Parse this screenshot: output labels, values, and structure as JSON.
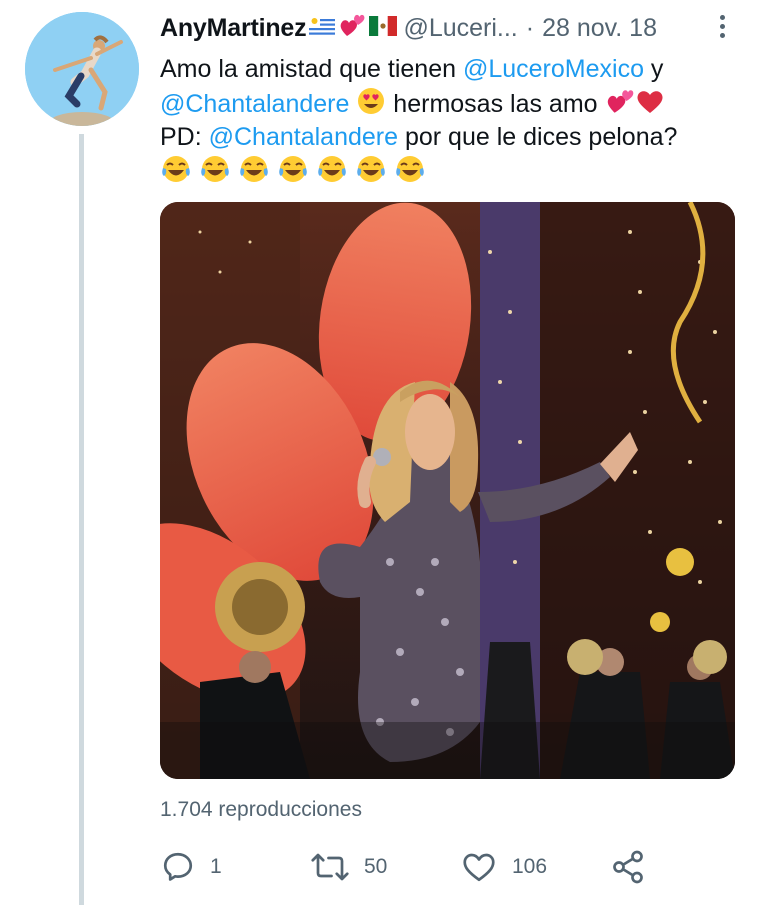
{
  "tweet": {
    "author_name": "AnyMartinez",
    "handle": "@Luceri...",
    "separator": "·",
    "date": "28 nov. 18",
    "text": {
      "line1_a": "Amo la amistad que tienen ",
      "line1_mention": "@LuceroMexico",
      "line1_b": " y",
      "line2_mention": "@Chantalandere",
      "line2_b": " hermosas las amo ",
      "line3_a": "PD: ",
      "line3_mention": "@Chantalandere",
      "line3_b": " por que le dices pelona?"
    },
    "views": "1.704 reproducciones",
    "actions": {
      "reply_count": "1",
      "retweet_count": "50",
      "like_count": "106"
    }
  },
  "icons": {
    "author_flags": [
      "uruguay-flag-icon",
      "two-hearts-icon",
      "mexico-flag-icon"
    ],
    "inline_emoji": [
      "heart-eyes-icon",
      "two-hearts-icon",
      "red-heart-icon",
      "tears-of-joy-icon"
    ],
    "actions": [
      "reply-icon",
      "retweet-icon",
      "like-icon",
      "share-icon"
    ]
  },
  "colors": {
    "link": "#1d9bf0",
    "secondary_text": "#536471",
    "thread_line": "#cfd9de"
  }
}
